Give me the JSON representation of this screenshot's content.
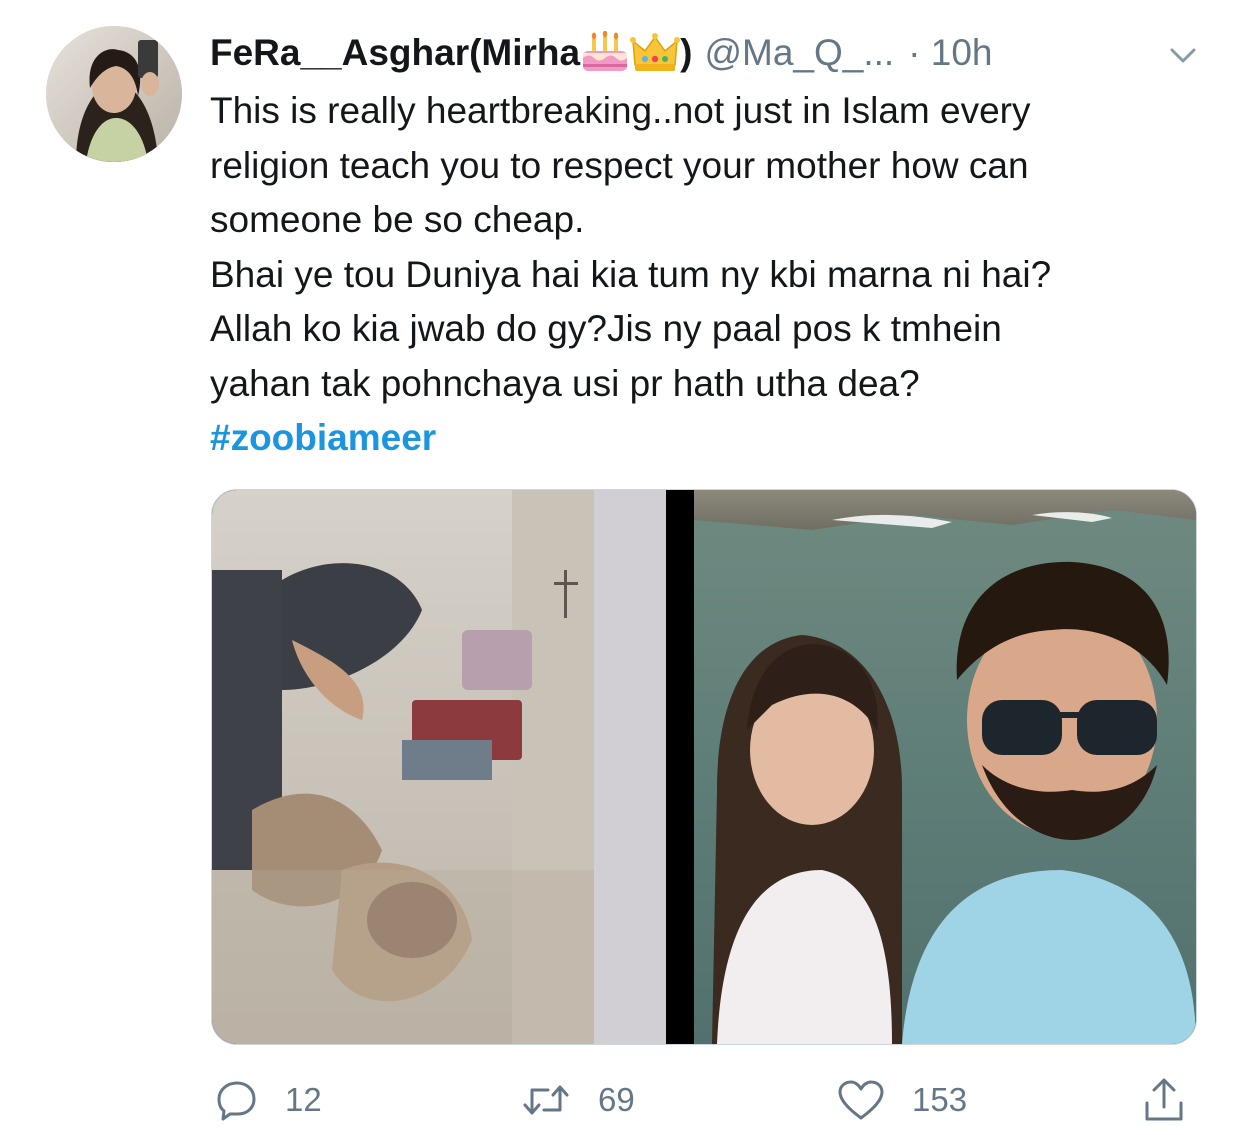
{
  "tweet": {
    "display_name": "FeRa__Asghar(Mirha",
    "display_name_emojis": [
      "birthday-cake",
      "crown"
    ],
    "display_name_close": ")",
    "handle": "@Ma_Q_...",
    "time": "· 10h",
    "text_lines": [
      "This is really heartbreaking..not just in Islam every",
      "religion teach you to respect your mother how can",
      "someone be so cheap.",
      "Bhai ye tou Duniya hai kia tum ny kbi marna ni hai?",
      "Allah ko kia jwab do gy?Jis ny paal pos k tmhein",
      "yahan tak pohnchaya usi pr hath utha dea?"
    ],
    "hashtag": "#zoobiameer"
  },
  "actions": {
    "reply_count": "12",
    "retweet_count": "69",
    "like_count": "153"
  },
  "colors": {
    "link": "#1b95e0",
    "muted": "#657786",
    "text": "#14171a",
    "border": "#ccd6dd"
  }
}
